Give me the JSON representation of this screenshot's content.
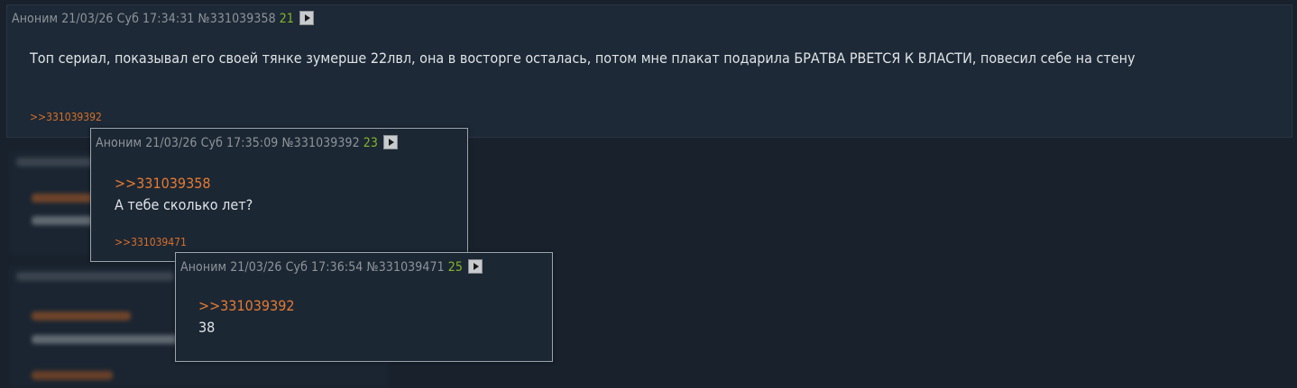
{
  "main_post": {
    "author": "Аноним",
    "date": "21/03/26 Суб 17:34:31",
    "post_number": "№331039358",
    "count": "21",
    "text": "Топ сериал, показывал его своей тянке зумерше 22лвл, она в восторге осталась, потом мне плакат подарила БРАТВА РВЕТСЯ К ВЛАСТИ, повесил себе на стену",
    "reply_link": ">>331039392"
  },
  "preview_1": {
    "author": "Аноним",
    "date": "21/03/26 Суб 17:35:09",
    "post_number": "№331039392",
    "count": "23",
    "quote": ">>331039358",
    "text": "А тебе сколько лет?",
    "reply_link": ">>331039471"
  },
  "preview_2": {
    "author": "Аноним",
    "date": "21/03/26 Суб 17:36:54",
    "post_number": "№331039471",
    "count": "25",
    "quote": ">>331039392",
    "text": "38"
  },
  "icons": {
    "play": "play-icon"
  },
  "colors": {
    "page_bg": "#18212c",
    "post_bg": "#1d2936",
    "link": "#e57a31",
    "count": "#88b528",
    "header": "#8e949b"
  }
}
